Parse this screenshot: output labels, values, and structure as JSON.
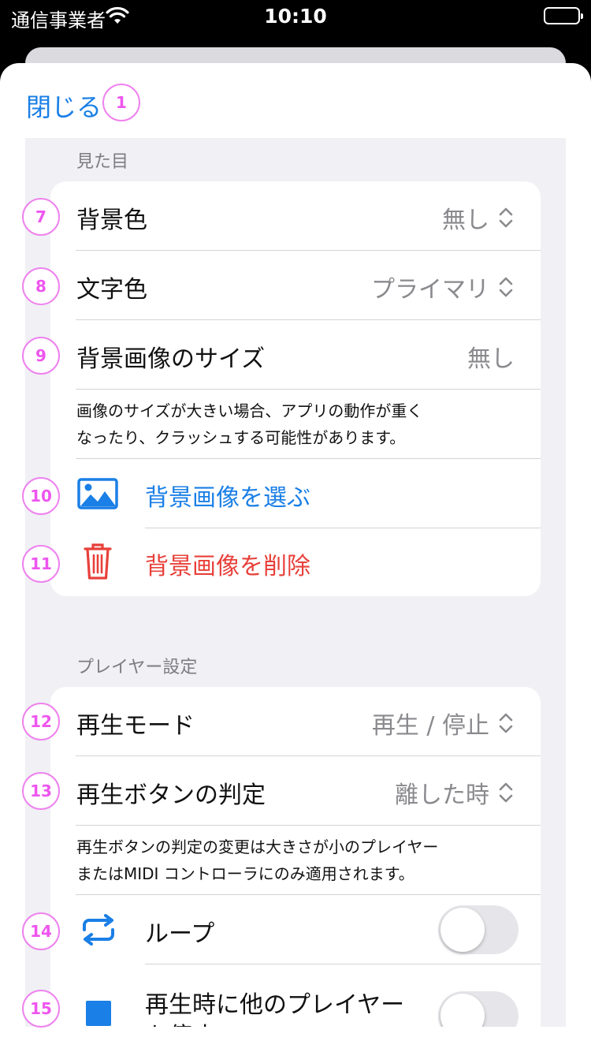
{
  "status_bar": {
    "carrier": "通信事業者",
    "time": "10:10"
  },
  "sheet": {
    "close_label": "閉じる"
  },
  "appearance": {
    "header": "見た目",
    "background_color": {
      "label": "背景色",
      "value": "無し"
    },
    "text_color": {
      "label": "文字色",
      "value": "プライマリ"
    },
    "bg_image_size": {
      "label": "背景画像のサイズ",
      "value": "無し"
    },
    "note_line1": "画像のサイズが大きい場合、アプリの動作が重く",
    "note_line2": "なったり、クラッシュする可能性があります。",
    "choose_image": "背景画像を選ぶ",
    "delete_image": "背景画像を削除"
  },
  "player_settings": {
    "header": "プレイヤー設定",
    "play_mode": {
      "label": "再生モード",
      "value": "再生 / 停止"
    },
    "play_button_judgment": {
      "label": "再生ボタンの判定",
      "value": "離した時"
    },
    "note_line1": "再生ボタンの判定の変更は大きさが小のプレイヤー",
    "note_line2": "またはMIDI コントローラにのみ適用されます。",
    "loop": {
      "label": "ループ",
      "on": false
    },
    "stop_others": {
      "label_line1": "再生時に他のプレイヤー",
      "label_line2": "を停止",
      "on": false
    }
  },
  "badges": {
    "close": "1",
    "bg_color": "7",
    "text_color": "8",
    "bg_size": "9",
    "choose": "10",
    "delete": "11",
    "play_mode": "12",
    "judgment": "13",
    "loop": "14",
    "stop_others": "15"
  },
  "colors": {
    "accent": "#1a7fe6",
    "destructive": "#e8403a",
    "grouped_background": "#f0f0f5",
    "annotation": "#ee82ee"
  }
}
